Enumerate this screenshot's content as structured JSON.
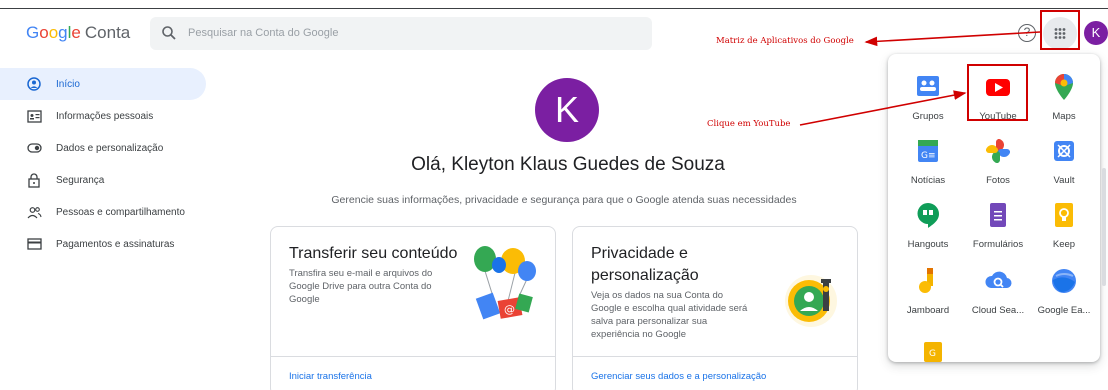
{
  "header": {
    "logo_google": "Google",
    "logo_conta": "Conta",
    "search_placeholder": "Pesquisar na Conta do Google",
    "help_glyph": "?",
    "avatar_letter": "K"
  },
  "sidebar": {
    "items": [
      {
        "label": "Início",
        "icon": "home-icon",
        "active": true
      },
      {
        "label": "Informações pessoais",
        "icon": "id-card-icon",
        "active": false
      },
      {
        "label": "Dados e personalização",
        "icon": "toggle-icon",
        "active": false
      },
      {
        "label": "Segurança",
        "icon": "lock-icon",
        "active": false
      },
      {
        "label": "Pessoas e compartilhamento",
        "icon": "people-icon",
        "active": false
      },
      {
        "label": "Pagamentos e assinaturas",
        "icon": "credit-card-icon",
        "active": false
      }
    ]
  },
  "main": {
    "avatar_letter": "K",
    "greeting": "Olá, Kleyton Klaus Guedes de Souza",
    "subtitle": "Gerencie suas informações, privacidade e segurança para que o Google atenda suas necessidades",
    "cards": [
      {
        "title": "Transferir seu conteúdo",
        "desc": [
          "Transfira seu e-mail e arquivos do",
          "Google Drive para outra Conta do",
          "Google"
        ],
        "link": "Iniciar transferência"
      },
      {
        "title": "Privacidade e personalização",
        "title_lines": [
          "Privacidade e",
          "personalização"
        ],
        "desc": [
          "Veja os dados na sua Conta do",
          "Google e escolha qual atividade será",
          "salva para personalizar sua",
          "experiência no Google"
        ],
        "link": "Gerenciar seus dados e a personalização"
      }
    ]
  },
  "apps": [
    {
      "label": "Grupos",
      "icon": "groups-icon"
    },
    {
      "label": "YouTube",
      "icon": "youtube-icon"
    },
    {
      "label": "Maps",
      "icon": "maps-icon"
    },
    {
      "label": "Notícias",
      "icon": "news-icon"
    },
    {
      "label": "Fotos",
      "icon": "photos-icon"
    },
    {
      "label": "Vault",
      "icon": "vault-icon"
    },
    {
      "label": "Hangouts",
      "icon": "hangouts-icon"
    },
    {
      "label": "Formulários",
      "icon": "forms-icon"
    },
    {
      "label": "Keep",
      "icon": "keep-icon"
    },
    {
      "label": "Jamboard",
      "icon": "jamboard-icon"
    },
    {
      "label": "Cloud Sea...",
      "icon": "cloud-search-icon"
    },
    {
      "label": "Google Ea...",
      "icon": "google-earth-icon"
    }
  ],
  "annotations": {
    "apps_matrix": "Matriz de Aplicativos do Google",
    "click_youtube": "Clique em YouTube"
  },
  "colors": {
    "accent_blue": "#1a73e8",
    "avatar_purple": "#7b1fa2",
    "annotation_red": "#d00000",
    "sidebar_active_bg": "#e8f0fe"
  }
}
